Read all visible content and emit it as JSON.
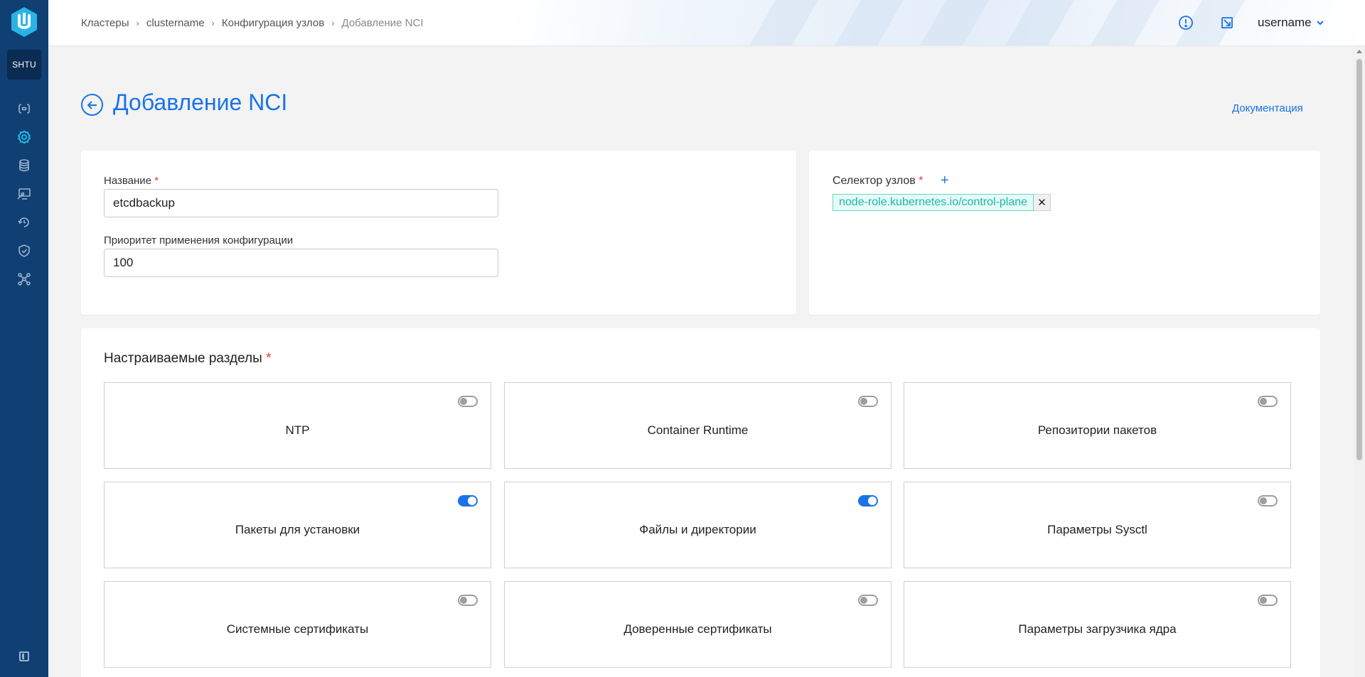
{
  "sidebar": {
    "org_badge": "SHTU",
    "items": [
      {
        "icon": "braces-icon"
      },
      {
        "icon": "gear-icon",
        "active": true
      },
      {
        "icon": "database-icon"
      },
      {
        "icon": "monitor-wrench-icon"
      },
      {
        "icon": "restore-icon"
      },
      {
        "icon": "shield-check-icon"
      },
      {
        "icon": "network-nodes-icon"
      }
    ],
    "collapse_icon": "sidebar-collapse-icon"
  },
  "header": {
    "breadcrumb": [
      "Кластеры",
      "clustername",
      "Конфигурация узлов",
      "Добавление NCI"
    ],
    "username": "username",
    "icons": [
      "alert-circle-icon",
      "external-window-icon",
      "chevron-down-icon"
    ]
  },
  "page": {
    "title": "Добавление NCI",
    "docs_link": "Документация"
  },
  "form": {
    "name_label": "Название",
    "name_value": "etcdbackup",
    "priority_label": "Приоритет применения конфигурации",
    "priority_value": "100",
    "required_mark": "*"
  },
  "selector": {
    "label": "Селектор узлов",
    "add_icon": "+",
    "chips": [
      {
        "label": "node-role.kubernetes.io/control-plane",
        "close": "✕"
      }
    ]
  },
  "sections": {
    "title": "Настраиваемые разделы",
    "tiles": [
      {
        "label": "NTP",
        "enabled": false
      },
      {
        "label": "Container Runtime",
        "enabled": false
      },
      {
        "label": "Репозитории пакетов",
        "enabled": false
      },
      {
        "label": "Пакеты для установки",
        "enabled": true
      },
      {
        "label": "Файлы и директории",
        "enabled": true
      },
      {
        "label": "Параметры Sysctl",
        "enabled": false
      },
      {
        "label": "Системные сертификаты",
        "enabled": false
      },
      {
        "label": "Доверенные сертификаты",
        "enabled": false
      },
      {
        "label": "Параметры загрузчика ядра",
        "enabled": false
      }
    ]
  },
  "colors": {
    "sidebar_bg": "#0f3f73",
    "accent": "#1a73e8",
    "active_icon": "#22c1e8",
    "chip_text": "#1fb6a4",
    "required": "#e53935"
  }
}
